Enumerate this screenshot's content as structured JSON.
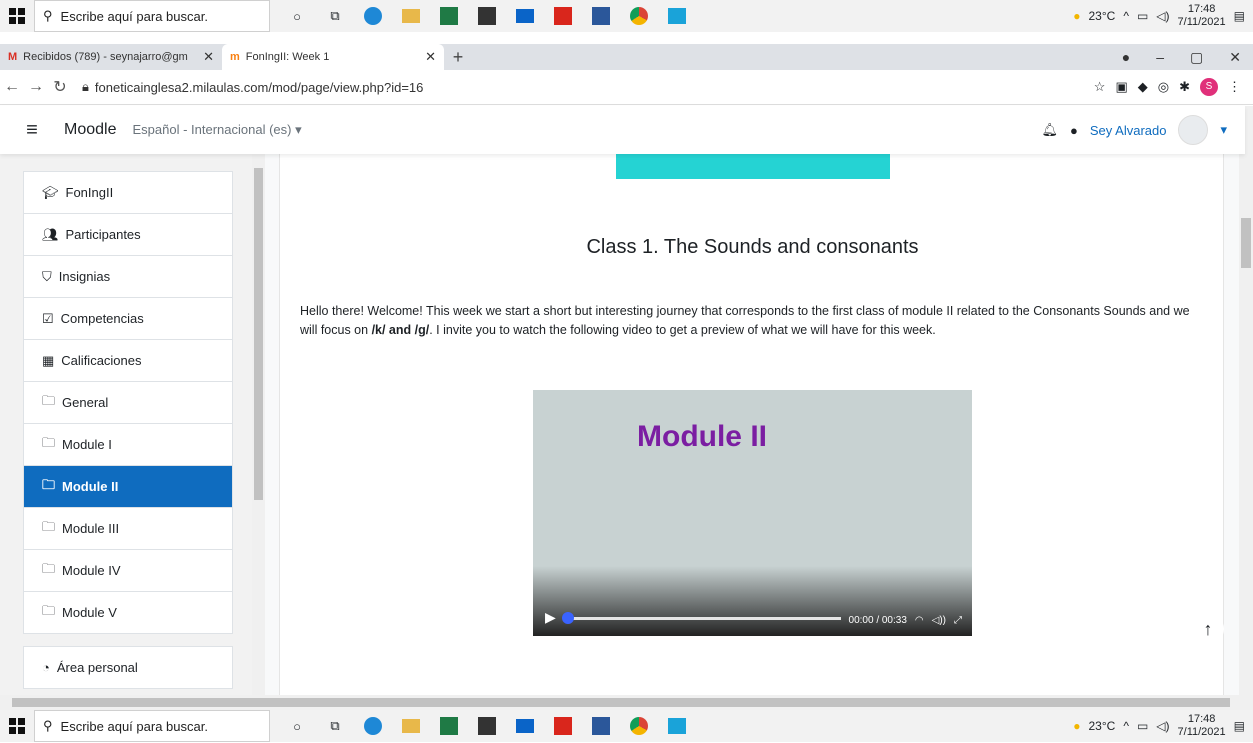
{
  "taskbar": {
    "search_placeholder": "Escribe aquí para buscar.",
    "weather": "23°C",
    "time": "17:48",
    "date": "7/11/2021"
  },
  "browser": {
    "tabs": [
      {
        "title": "Recibidos (789) - seynajarro@gm",
        "close": "✕"
      },
      {
        "title": "FonIngII: Week 1",
        "close": "✕"
      }
    ],
    "new_tab": "+",
    "url": "foneticainglesa2.milaulas.com/mod/page/view.php?id=16",
    "window": {
      "minimize": "–",
      "maximize": "▢",
      "close": "✕"
    },
    "profile_initial": "S"
  },
  "moodle": {
    "brand": "Moodle",
    "language": "Español - Internacional (es) ▾",
    "user": "Sey Alvarado"
  },
  "sidebar": {
    "items": [
      {
        "label": "FonIngII",
        "icon": "graduation-cap-icon"
      },
      {
        "label": "Participantes",
        "icon": "users-icon"
      },
      {
        "label": "Insignias",
        "icon": "shield-icon"
      },
      {
        "label": "Competencias",
        "icon": "checkbox-icon"
      },
      {
        "label": "Calificaciones",
        "icon": "table-icon"
      },
      {
        "label": "General",
        "icon": "folder-icon"
      },
      {
        "label": "Module I",
        "icon": "folder-icon"
      },
      {
        "label": "Module II",
        "icon": "folder-icon"
      },
      {
        "label": "Module III",
        "icon": "folder-icon"
      },
      {
        "label": "Module IV",
        "icon": "folder-icon"
      },
      {
        "label": "Module V",
        "icon": "folder-icon"
      },
      {
        "label": "Área personal",
        "icon": "dashboard-icon"
      }
    ]
  },
  "page": {
    "heading": "Class 1. The Sounds and consonants",
    "para_before": "Hello there! Welcome! This week we start a short but interesting journey that corresponds to the first class of module II related to the Consonants Sounds and we will focus on ",
    "para_bold": "/k/ and /g/",
    "para_after": ". I invite you to watch the following video to get a preview of what we will have for this week."
  },
  "video": {
    "title": "Module II",
    "time": "00:00 / 00:33"
  },
  "colors": {
    "accent": "#0f6cbf",
    "banner": "#25d3d3",
    "video_title": "#7b1ea2"
  }
}
